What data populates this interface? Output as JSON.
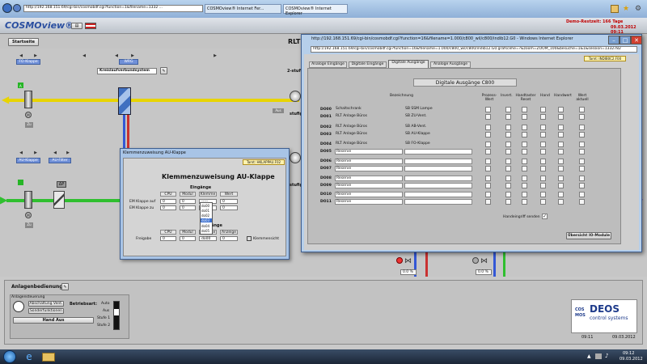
{
  "browser": {
    "address1": "http://192.168.151.69/cgi-bin/cosmobdf.cgi?function=1&filename=1332 ...",
    "tab1": "COSMOview® Internet Fer...",
    "tab2": "COSMOview® Internet Explorer"
  },
  "header": {
    "logo": "COSMOview®",
    "demo": "Demo-Restzeit: 166 Tage",
    "datetime": "09.03.2012 09:11",
    "startseite": "Startseite",
    "rlt": "RLT"
  },
  "plant": {
    "fo_klappe": "FO-Klappe",
    "wrg": "WRG",
    "kreislauf_select": "Kreislaufverbundsystem",
    "au_klappe": "AU-Klappe",
    "au_filter": "AU-Filter",
    "zu": "Zu",
    "aus": "Aus",
    "stufe": "2-stufig",
    "fo2": "FO2",
    "stufig_mid": "stufig",
    "stufig_low": "stufig",
    "dp": "ΔP",
    "valve_left": "0.0 %",
    "valve_right": "0.0 %"
  },
  "anlagenbedienung": {
    "title": "Anlagenbedienung",
    "group": "Anlagensteuerung",
    "abschaltung": "Abschaltung Vent.",
    "sonder": "Sonderfunktionen",
    "betriebsart": "Betriebsart:",
    "hand_aus": "Hand Aus",
    "auto": "Auto",
    "aus": "Aus",
    "stufe1": "Stufe 1",
    "stufe2": "Stufe 2"
  },
  "deos": {
    "cos": "COS",
    "mos": "MOS",
    "name": "DEOS",
    "sub": "control systems",
    "time": "09:11",
    "date": "09.03.2012"
  },
  "dialog_small": {
    "title": "Klemmenzuweisung AU-Klappe",
    "tarn": "Tarnt: HKLAPPAU.F02",
    "heading": "Klemmenzuweisung AU-Klappe",
    "eingaenge": "Eingänge",
    "cols": [
      "CPU",
      "Modul",
      "Klemme",
      "Wert"
    ],
    "row1_label": "EM Klappe auf",
    "row2_label": "EM Klappe zu",
    "row1": [
      "0",
      "0",
      "-----",
      "0"
    ],
    "row2": [
      "0",
      "0",
      "-----",
      "0"
    ],
    "ausgaenge": "Ausgänge",
    "out_cols": [
      "CPU",
      "Modul",
      "Klemme",
      "Anzeige"
    ],
    "freigabe_label": "Freigabe",
    "freigabe": [
      "0",
      "0",
      "do00",
      "0"
    ],
    "dropdown": [
      "do00",
      "do01",
      "do02",
      "do03",
      "do04",
      "do05"
    ],
    "klemmensicht": "Klemmensicht"
  },
  "ie_window": {
    "titlebar": "http://192.168.151.69/cgi-bin/cosmobdf.cgi?function=16&filename=1.000/c800_wil/c800/indib12.G0 - Windows Internet Explorer",
    "address": "http://192.168.151.69/cgi-bin/cosmobdf.cgi?function=16&filename=1.000/c800_wil/c800/indib12.G0.grafscehe=?&zoom=ZOOM_100&besuche=1&1&session=1332782",
    "tarnt": "Tarnt: INDIB0C2.F00",
    "tabs": [
      "Analoge Eingänge",
      "Digitale Eingänge",
      "Digitale Ausgänge",
      "Analoge Ausgänge"
    ],
    "panel_title": "Digitale Ausgänge  C800",
    "col_bezeichnung": "Bezeichnung",
    "col_prozesswert": "Prozess-Wert",
    "col_invert": "Invert.",
    "col_handtaster": "Handtaster Reset",
    "col_hand": "Hand",
    "col_handwert": "Handwert",
    "col_wert": "Wert aktuell",
    "rows": [
      {
        "id": "DO00",
        "name": "Schaltschrank",
        "desc": "SB SSM Lampe"
      },
      {
        "id": "DO01",
        "name": "RLT Anlage Büros",
        "desc": "SB ZU-Vent."
      },
      {
        "id": "DO02",
        "name": "RLT Anlage Büros",
        "desc": "SB AB-Vent."
      },
      {
        "id": "DO03",
        "name": "RLT Anlage Büros",
        "desc": "SB AU-Klappe"
      },
      {
        "id": "DO04",
        "name": "RLT Anlage Büros",
        "desc": "SB FO-Klappe"
      },
      {
        "id": "DO05",
        "name": "Reserve",
        "desc": ""
      },
      {
        "id": "DO06",
        "name": "Reserve",
        "desc": ""
      },
      {
        "id": "DO07",
        "name": "Reserve",
        "desc": ""
      },
      {
        "id": "DO08",
        "name": "Reserve",
        "desc": ""
      },
      {
        "id": "DO09",
        "name": "Reserve",
        "desc": ""
      },
      {
        "id": "DO10",
        "name": "Reserve",
        "desc": ""
      },
      {
        "id": "DO11",
        "name": "Reserve",
        "desc": ""
      }
    ],
    "handeingriff": "Handeingriff senden",
    "uebersicht": "Übersicht IO-Module"
  },
  "taskbar": {
    "time": "09:12",
    "date": "09.03.2012"
  }
}
